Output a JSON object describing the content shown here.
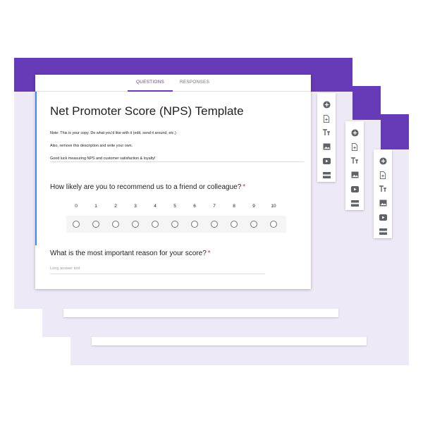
{
  "form": {
    "tabs": {
      "questions": "QUESTIONS",
      "responses": "RESPONSES"
    },
    "title": "Net Promoter Score (NPS) Template",
    "description": [
      "Note: This is your copy. Do what you'd like with it (edit, send it around, etc.)",
      "Also, remove this description and write your own.",
      "Good luck measuring NPS and customer satisfaction & loyalty!"
    ],
    "questions": [
      {
        "text": "How likely are you to recommend us to a friend or colleague?",
        "required_mark": "*",
        "scale": [
          "0",
          "1",
          "2",
          "3",
          "4",
          "5",
          "6",
          "7",
          "8",
          "9",
          "10"
        ]
      },
      {
        "text": "What is the most important reason for your score?",
        "required_mark": "*",
        "placeholder": "Long answer text"
      }
    ]
  },
  "toolbar": {
    "icons": [
      "add-question-icon",
      "import-questions-icon",
      "add-title-icon",
      "add-image-icon",
      "add-video-icon",
      "add-section-icon"
    ]
  },
  "colors": {
    "brand": "#673ab7",
    "background": "#ede9f7",
    "accent": "#4285f4",
    "required": "#d93025"
  }
}
